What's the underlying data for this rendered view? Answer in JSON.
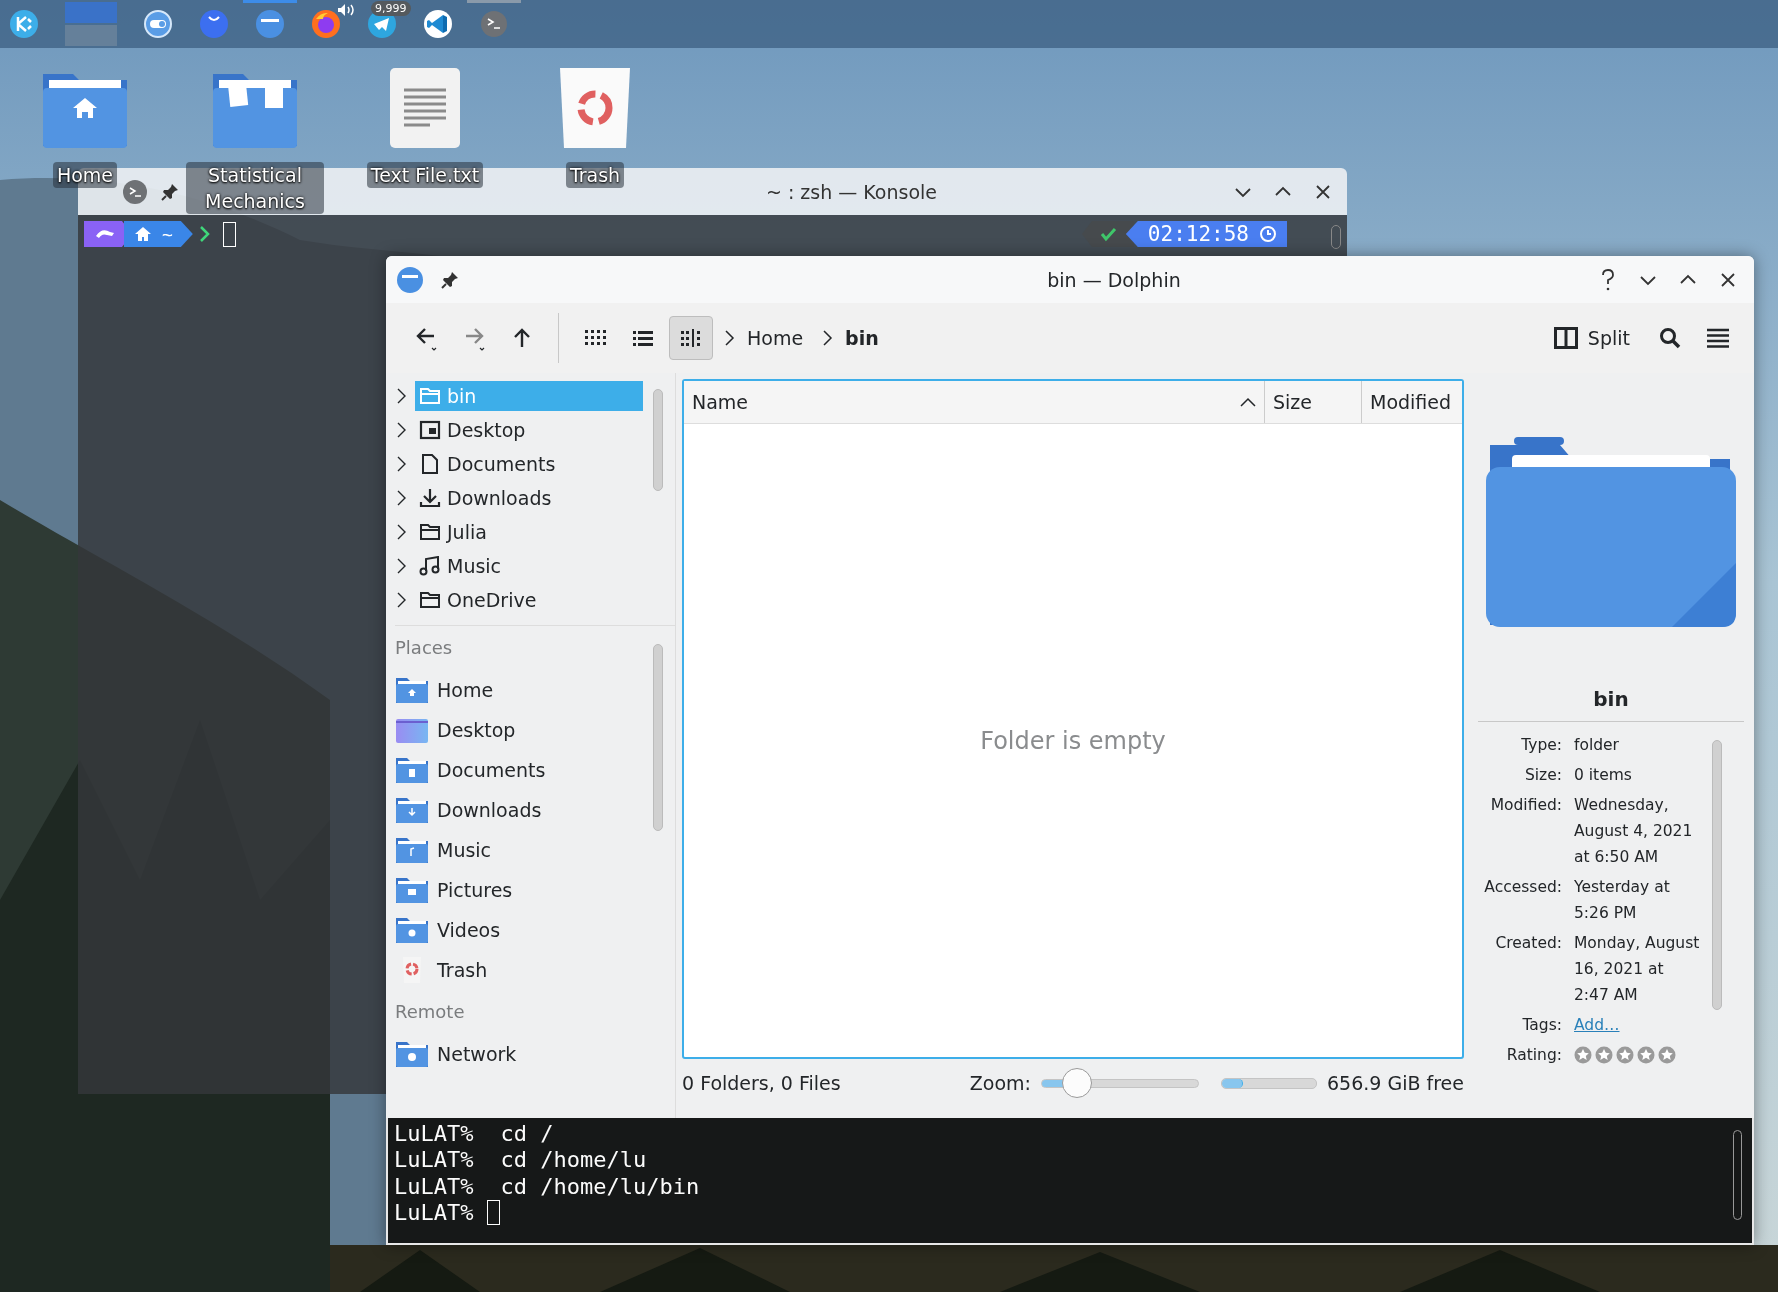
{
  "panel": {
    "items": [
      {
        "kind": "menu",
        "active": false,
        "open": false
      },
      {
        "kind": "pager",
        "active": false,
        "open": false,
        "desktops": [
          {
            "selected": true
          },
          {
            "selected": false
          }
        ]
      },
      {
        "kind": "toggle",
        "active": false,
        "open": false
      },
      {
        "kind": "smile",
        "active": false,
        "open": false
      },
      {
        "kind": "folder",
        "active": true,
        "open": true
      },
      {
        "kind": "browser",
        "active": false,
        "open": false,
        "audio": true
      },
      {
        "kind": "messenger",
        "active": false,
        "open": false,
        "badge": "9,999"
      },
      {
        "kind": "editor",
        "active": false,
        "open": false
      },
      {
        "kind": "terminal",
        "active": false,
        "open": true
      }
    ]
  },
  "desktop_icons": [
    {
      "kind": "home-folder",
      "label": "Home"
    },
    {
      "kind": "docs-folder",
      "label": "Statistical Mechanics"
    },
    {
      "kind": "text-file",
      "label": "Text File.txt"
    },
    {
      "kind": "trash",
      "label": "Trash"
    }
  ],
  "konsole": {
    "title": "~ : zsh — Konsole",
    "prompt_path": "~",
    "time": "02:12:58"
  },
  "dolphin": {
    "title": "bin — Dolphin",
    "toolbar": {
      "views": [
        {
          "kind": "icons",
          "selected": false
        },
        {
          "kind": "compact",
          "selected": false
        },
        {
          "kind": "details",
          "selected": true
        }
      ],
      "breadcrumb": [
        {
          "label": "Home",
          "current": false
        },
        {
          "label": "bin",
          "current": true
        }
      ],
      "split": "Split"
    },
    "tree": [
      {
        "kind": "folder",
        "label": "bin",
        "selected": true,
        "expanded": false
      },
      {
        "kind": "desktop",
        "label": "Desktop",
        "selected": false,
        "expanded": false
      },
      {
        "kind": "document",
        "label": "Documents",
        "selected": false,
        "expanded": false
      },
      {
        "kind": "download",
        "label": "Downloads",
        "selected": false,
        "expanded": false
      },
      {
        "kind": "folder",
        "label": "Julia",
        "selected": false,
        "expanded": false
      },
      {
        "kind": "music",
        "label": "Music",
        "selected": false,
        "expanded": false
      },
      {
        "kind": "folder",
        "label": "OneDrive",
        "selected": false,
        "expanded": false
      }
    ],
    "places": [
      {
        "heading": "Places",
        "items": [
          {
            "kind": "home",
            "label": "Home",
            "selected": false
          },
          {
            "kind": "desktop",
            "label": "Desktop",
            "selected": false
          },
          {
            "kind": "documents",
            "label": "Documents",
            "selected": false
          },
          {
            "kind": "downloads",
            "label": "Downloads",
            "selected": false
          },
          {
            "kind": "music",
            "label": "Music",
            "selected": false
          },
          {
            "kind": "pictures",
            "label": "Pictures",
            "selected": false
          },
          {
            "kind": "videos",
            "label": "Videos",
            "selected": false
          },
          {
            "kind": "trash",
            "label": "Trash",
            "selected": false
          }
        ]
      },
      {
        "heading": "Remote",
        "items": [
          {
            "kind": "network",
            "label": "Network",
            "selected": false
          }
        ]
      }
    ],
    "columns": [
      {
        "label": "Name",
        "sorted": true
      },
      {
        "label": "Size",
        "sorted": false
      },
      {
        "label": "Modified",
        "sorted": false
      }
    ],
    "empty_message": "Folder is empty",
    "status": {
      "counts": "0 Folders, 0 Files",
      "zoom_label": "Zoom:",
      "zoom": {
        "level": 0.23
      },
      "space": {
        "level": 0.22
      },
      "free": "656.9 GiB free"
    },
    "info": {
      "name": "bin",
      "fields": [
        {
          "label": "Type:",
          "value": "folder"
        },
        {
          "label": "Size:",
          "value": "0 items"
        },
        {
          "label": "Modified:",
          "value": "Wednesday, August 4, 2021 at 6:50 AM"
        },
        {
          "label": "Accessed:",
          "value": "Yesterday at 5:26 PM"
        },
        {
          "label": "Created:",
          "value": "Monday, August 16, 2021 at 2:47 AM"
        }
      ],
      "tags": {
        "label": "Tags:",
        "link": "Add…"
      },
      "rating": {
        "label": "Rating:",
        "stars": 0
      }
    },
    "terminal": [
      {
        "prompt": "LuLAT%",
        "command": "cd /",
        "cursor": false
      },
      {
        "prompt": "LuLAT%",
        "command": "cd /home/lu",
        "cursor": false
      },
      {
        "prompt": "LuLAT%",
        "command": "cd /home/lu/bin",
        "cursor": false
      },
      {
        "prompt": "LuLAT%",
        "cursor": true
      }
    ]
  }
}
